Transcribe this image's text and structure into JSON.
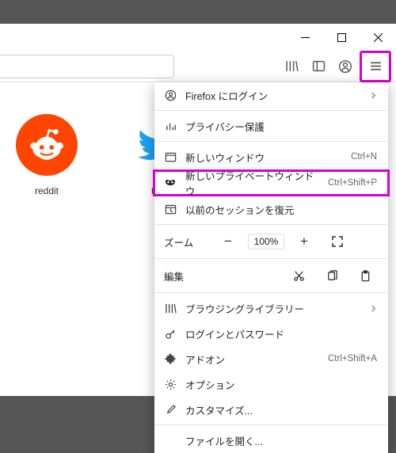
{
  "menu": {
    "login": "Firefox にログイン",
    "privacy": "プライバシー保護",
    "newWindow": "新しいウィンドウ",
    "newWindowShort": "Ctrl+N",
    "newPrivate": "新しいプライベートウィンドウ",
    "newPrivateShort": "Ctrl+Shift+P",
    "restore": "以前のセッションを復元",
    "zoomLabel": "ズーム",
    "zoomValue": "100%",
    "editLabel": "編集",
    "library": "ブラウジングライブラリー",
    "logins": "ログインとパスワード",
    "addons": "アドオン",
    "addonsShort": "Ctrl+Shift+A",
    "options": "オプション",
    "customize": "カスタマイズ...",
    "openFile": "ファイルを開く..."
  },
  "sites": {
    "reddit": "reddit",
    "twitter": "tw"
  }
}
